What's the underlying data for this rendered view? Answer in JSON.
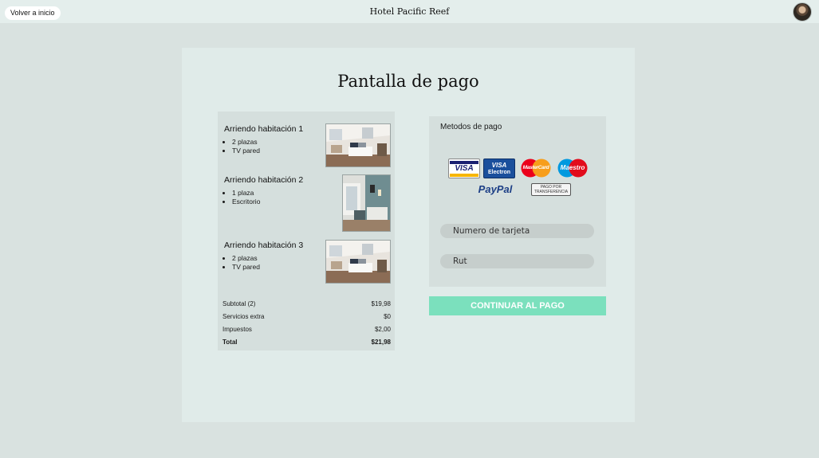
{
  "header": {
    "back_label": "Volver a inicio",
    "hotel_name": "Hotel Pacific Reef",
    "avatar_icon": "user-avatar"
  },
  "main": {
    "title": "Pantalla de pago"
  },
  "rooms": [
    {
      "title": "Arriendo habitación 1",
      "features": [
        "2 plazas",
        "TV pared"
      ]
    },
    {
      "title": "Arriendo habitación 2",
      "features": [
        "1 plaza",
        "Escritorio"
      ]
    },
    {
      "title": "Arriendo habitación 3",
      "features": [
        "2 plazas",
        "TV pared"
      ]
    }
  ],
  "totals": [
    {
      "label": "Subtotal (2)",
      "value": "$19,98"
    },
    {
      "label": "Servicios extra",
      "value": "$0"
    },
    {
      "label": "Impuestos",
      "value": "$2,00"
    },
    {
      "label": "Total",
      "value": "$21,98"
    }
  ],
  "payment": {
    "methods_title": "Metodos de pago",
    "cards": {
      "visa": "VISA",
      "visa_electron_top": "VISA",
      "visa_electron_bottom": "Electron",
      "mastercard": "MasterCard",
      "maestro": "Maestro",
      "paypal": "PayPal",
      "transfer_top": "PAGO POR",
      "transfer_bottom": "TRANSFERENCIA"
    },
    "card_number_placeholder": "Numero de tarjeta",
    "rut_placeholder": "Rut",
    "continue_label": "CONTINUAR AL PAGO"
  },
  "colors": {
    "background": "#d9e2e0",
    "panel": "#e0ebe9",
    "accent_button": "#7be0bd"
  }
}
